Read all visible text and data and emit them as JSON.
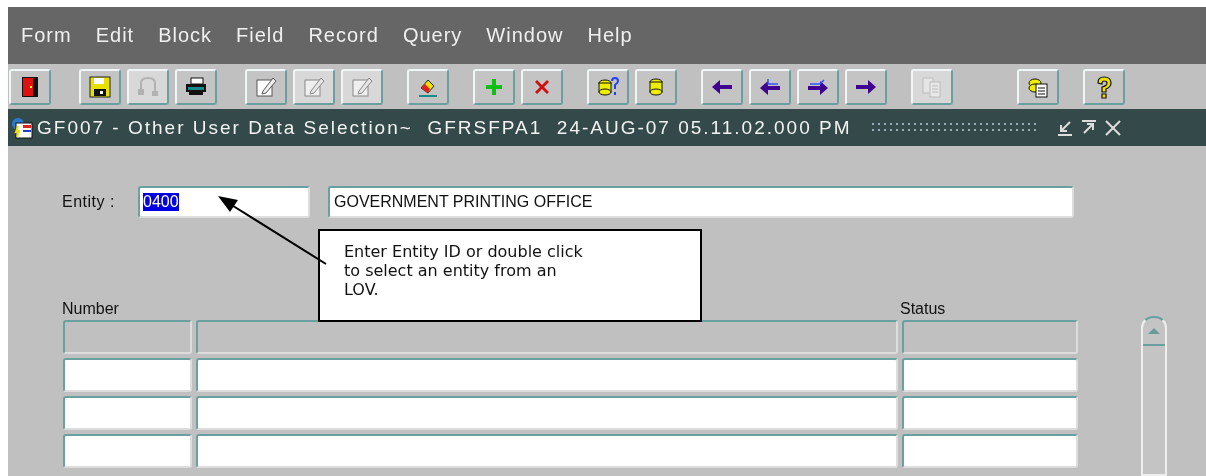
{
  "menu": [
    {
      "label": "Form"
    },
    {
      "label": "Edit"
    },
    {
      "label": "Block"
    },
    {
      "label": "Field"
    },
    {
      "label": "Record"
    },
    {
      "label": "Query"
    },
    {
      "label": "Window"
    },
    {
      "label": "Help"
    }
  ],
  "toolbar": [
    [
      {
        "kind": "exit",
        "disabled": false
      }
    ],
    [
      {
        "kind": "save",
        "disabled": false
      },
      {
        "kind": "undo",
        "disabled": true
      },
      {
        "kind": "print",
        "disabled": false
      }
    ],
    [
      {
        "kind": "edit",
        "disabled": false
      },
      {
        "kind": "edit",
        "disabled": true
      },
      {
        "kind": "edit",
        "disabled": true
      }
    ],
    [
      {
        "kind": "eraser",
        "disabled": false
      }
    ],
    [
      {
        "kind": "insert",
        "disabled": false
      },
      {
        "kind": "delete",
        "disabled": false
      }
    ],
    [
      {
        "kind": "query",
        "disabled": false
      },
      {
        "kind": "database",
        "disabled": false
      }
    ],
    [
      {
        "kind": "left",
        "disabled": false
      },
      {
        "kind": "leftbar",
        "disabled": false
      },
      {
        "kind": "rightbar",
        "disabled": false
      },
      {
        "kind": "right",
        "disabled": false
      }
    ],
    [
      {
        "kind": "copy",
        "disabled": true
      }
    ],
    [
      {
        "kind": "list",
        "disabled": false
      }
    ],
    [
      {
        "kind": "help",
        "disabled": false
      }
    ]
  ],
  "window": {
    "title": "GF007 - Other User Data Selection~  GFRSFPA1  24-AUG-07 05.11.02.000 PM"
  },
  "entity": {
    "label": "Entity :",
    "value": "0400",
    "selected": true,
    "description": "GOVERNMENT PRINTING OFFICE"
  },
  "callout": {
    "text": "Enter Entity ID or double click\nto select an entity from an\nLOV."
  },
  "table": {
    "columns": [
      {
        "label": "Number"
      },
      {
        "label": "Status"
      }
    ],
    "rows": [
      {
        "disabled": true
      },
      {
        "disabled": false
      },
      {
        "disabled": false
      },
      {
        "disabled": false
      }
    ]
  }
}
